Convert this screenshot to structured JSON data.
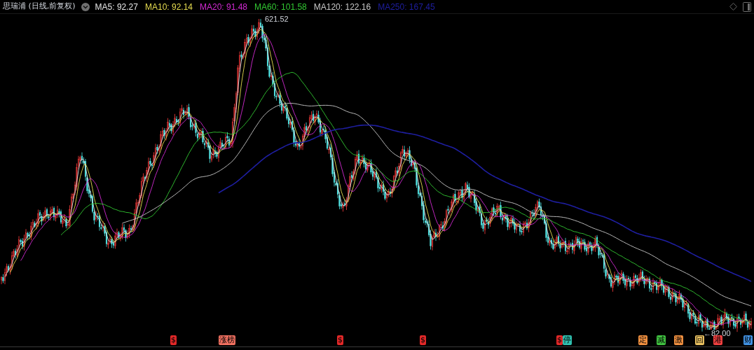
{
  "title": "思瑞浦 (日线,前复权)",
  "moving_averages": [
    {
      "label": "MA5: 92.27",
      "color": "#e6e6e6"
    },
    {
      "label": "MA10: 92.14",
      "color": "#e6dc50"
    },
    {
      "label": "MA20: 91.48",
      "color": "#d22ad2"
    },
    {
      "label": "MA60: 101.58",
      "color": "#32c832"
    },
    {
      "label": "MA120: 122.16",
      "color": "#c8c8c8"
    },
    {
      "label": "MA250: 167.45",
      "color": "#1e1ea0"
    }
  ],
  "annotations": [
    {
      "kind": "high",
      "text": "621.52"
    },
    {
      "kind": "low",
      "text": "←82.00"
    }
  ],
  "event_markers": [
    {
      "text": "$",
      "color": "#e02828"
    },
    {
      "text": "涨榜",
      "color": "#f07060"
    },
    {
      "text": "$",
      "color": "#e02828"
    },
    {
      "text": "$",
      "color": "#e02828"
    },
    {
      "text": "$",
      "color": "#e02828"
    },
    {
      "text": "停",
      "color": "#30c0b0"
    },
    {
      "text": "定",
      "color": "#f09040"
    },
    {
      "text": "减",
      "color": "#40c040"
    },
    {
      "text": "激",
      "color": "#f09040"
    },
    {
      "text": "回",
      "color": "#e8c060"
    },
    {
      "text": "港",
      "color": "#f04040"
    },
    {
      "text": "财",
      "color": "#4090e0"
    }
  ]
}
